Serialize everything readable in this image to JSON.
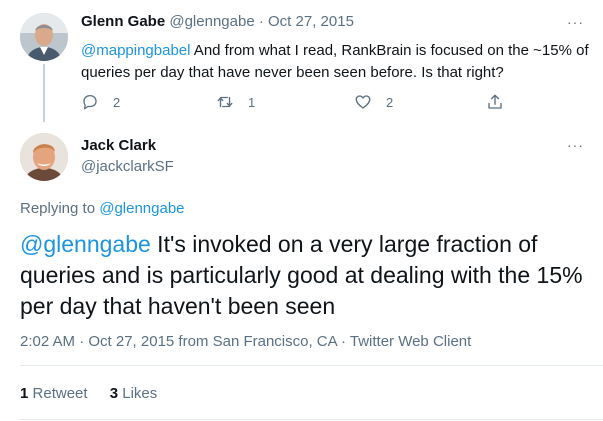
{
  "reply_tweet": {
    "name": "Glenn Gabe",
    "handle": "@glenngabe",
    "separator": "·",
    "date": "Oct 27, 2015",
    "mention": "@mappingbabel",
    "text": " And from what I read, RankBrain is focused on the ~15% of queries per day that have never been seen before. Is that right?",
    "more_icon": "···",
    "actions": {
      "reply_count": "2",
      "retweet_count": "1",
      "like_count": "2"
    }
  },
  "main_tweet": {
    "name": "Jack Clark",
    "handle": "@jackclarkSF",
    "more_icon": "···",
    "replying_to_prefix": "Replying to ",
    "replying_to_handle": "@glenngabe",
    "mention": "@glenngabe",
    "text": " It's invoked on a very large fraction of queries and is particularly good at dealing with the 15% per day that haven't been seen",
    "meta": "2:02 AM · Oct 27, 2015 from San Francisco, CA · Twitter Web Client",
    "retweets": {
      "count": "1",
      "label": "Retweet"
    },
    "likes": {
      "count": "3",
      "label": "Likes"
    }
  },
  "colors": {
    "link": "#1b95e0",
    "muted": "#5b7083",
    "text": "#0f1419",
    "divider": "#e1e8ed"
  }
}
